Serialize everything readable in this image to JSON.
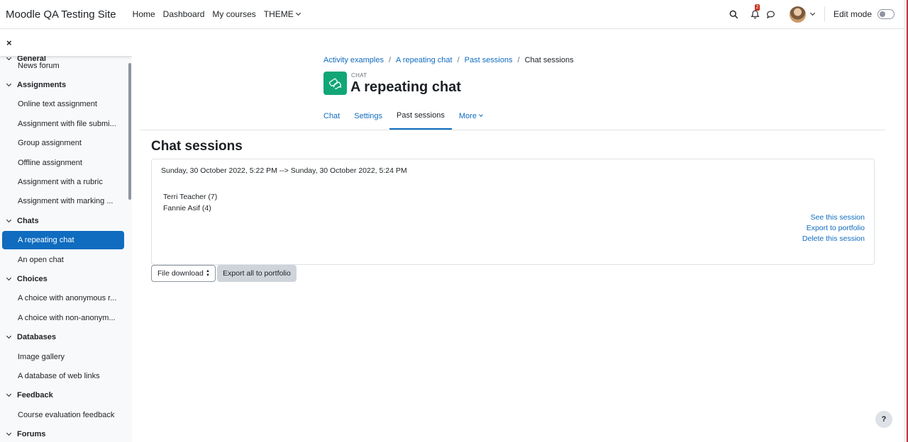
{
  "navbar": {
    "site_name": "Moodle QA Testing Site",
    "links": [
      "Home",
      "Dashboard",
      "My courses",
      "THEME"
    ],
    "notification_count": "2",
    "edit_mode_label": "Edit mode"
  },
  "drawer": {
    "close_glyph": "×",
    "partial_top_label": "General",
    "entries": [
      {
        "kind": "item",
        "label": "News forum"
      },
      {
        "kind": "section",
        "label": "Assignments"
      },
      {
        "kind": "item",
        "label": "Online text assignment"
      },
      {
        "kind": "item",
        "label": "Assignment with file submi..."
      },
      {
        "kind": "item",
        "label": "Group assignment"
      },
      {
        "kind": "item",
        "label": "Offline assignment"
      },
      {
        "kind": "item",
        "label": "Assignment with a rubric"
      },
      {
        "kind": "item",
        "label": "Assignment with marking ..."
      },
      {
        "kind": "section",
        "label": "Chats"
      },
      {
        "kind": "item",
        "label": "A repeating chat",
        "active": true
      },
      {
        "kind": "item",
        "label": "An open chat"
      },
      {
        "kind": "section",
        "label": "Choices"
      },
      {
        "kind": "item",
        "label": "A choice with anonymous r..."
      },
      {
        "kind": "item",
        "label": "A choice with non-anonym..."
      },
      {
        "kind": "section",
        "label": "Databases"
      },
      {
        "kind": "item",
        "label": "Image gallery"
      },
      {
        "kind": "item",
        "label": "A database of web links"
      },
      {
        "kind": "section",
        "label": "Feedback"
      },
      {
        "kind": "item",
        "label": "Course evaluation feedback"
      },
      {
        "kind": "section",
        "label": "Forums"
      }
    ]
  },
  "breadcrumb": [
    "Activity examples",
    "A repeating chat",
    "Past sessions",
    "Chat sessions"
  ],
  "activity": {
    "module_label": "CHAT",
    "title": "A repeating chat"
  },
  "tabs": [
    {
      "label": "Chat",
      "active": false
    },
    {
      "label": "Settings",
      "active": false
    },
    {
      "label": "Past sessions",
      "active": true
    },
    {
      "label": "More",
      "active": false
    }
  ],
  "main": {
    "heading": "Chat sessions",
    "session": {
      "range": "Sunday, 30 October 2022, 5:22 PM --> Sunday, 30 October 2022, 5:24 PM",
      "users": [
        "Terri Teacher (7)",
        "Fannie Asif (4)"
      ],
      "links": [
        "See this session",
        "Export to portfolio",
        "Delete this session"
      ]
    },
    "download_select_value": "File download",
    "export_all_label": "Export all to portfolio"
  },
  "help_label": "?",
  "colors": {
    "primary": "#0f6cbf",
    "chat_icon_bg": "#11a676",
    "badge": "#ca3120"
  }
}
